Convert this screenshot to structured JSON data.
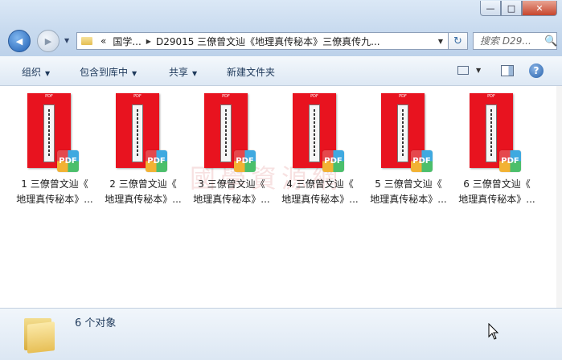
{
  "window": {
    "minimize_label": "—",
    "maximize_label": "□",
    "close_label": "✕"
  },
  "nav": {
    "back_label": "◀",
    "forward_label": "▶",
    "history_dropdown": "▼"
  },
  "address": {
    "overflow": "«",
    "crumbs": [
      "国学...",
      "D29015 三僚曾文辿《地理真传秘本》三僚真传九..."
    ],
    "separator": "▶",
    "dropdown": "▼",
    "refresh_icon": "↻"
  },
  "search": {
    "placeholder": "搜索 D29...",
    "icon": "🔍"
  },
  "toolbar": {
    "organize": "组织",
    "include_in_library": "包含到库中",
    "share": "共享",
    "new_folder": "新建文件夹",
    "arrow": "▼",
    "help": "?"
  },
  "files": [
    {
      "line1": "1 三僚曾文辿《",
      "line2": "地理真传秘本》..."
    },
    {
      "line1": "2 三僚曾文辿《",
      "line2": "地理真传秘本》..."
    },
    {
      "line1": "3 三僚曾文辿《",
      "line2": "地理真传秘本》..."
    },
    {
      "line1": "4 三僚曾文辿《",
      "line2": "地理真传秘本》..."
    },
    {
      "line1": "5 三僚曾文辿《",
      "line2": "地理真传秘本》..."
    },
    {
      "line1": "6 三僚曾文辿《",
      "line2": "地理真传秘本》..."
    }
  ],
  "thumb_tag": "PDF",
  "pdf_badge": "PDF",
  "watermark": "國學資源網",
  "status": {
    "object_count": "6 个对象"
  },
  "colors": {
    "thumb": "#e8131f",
    "chrome": "#c9dbef",
    "command_text": "#1e395b"
  }
}
